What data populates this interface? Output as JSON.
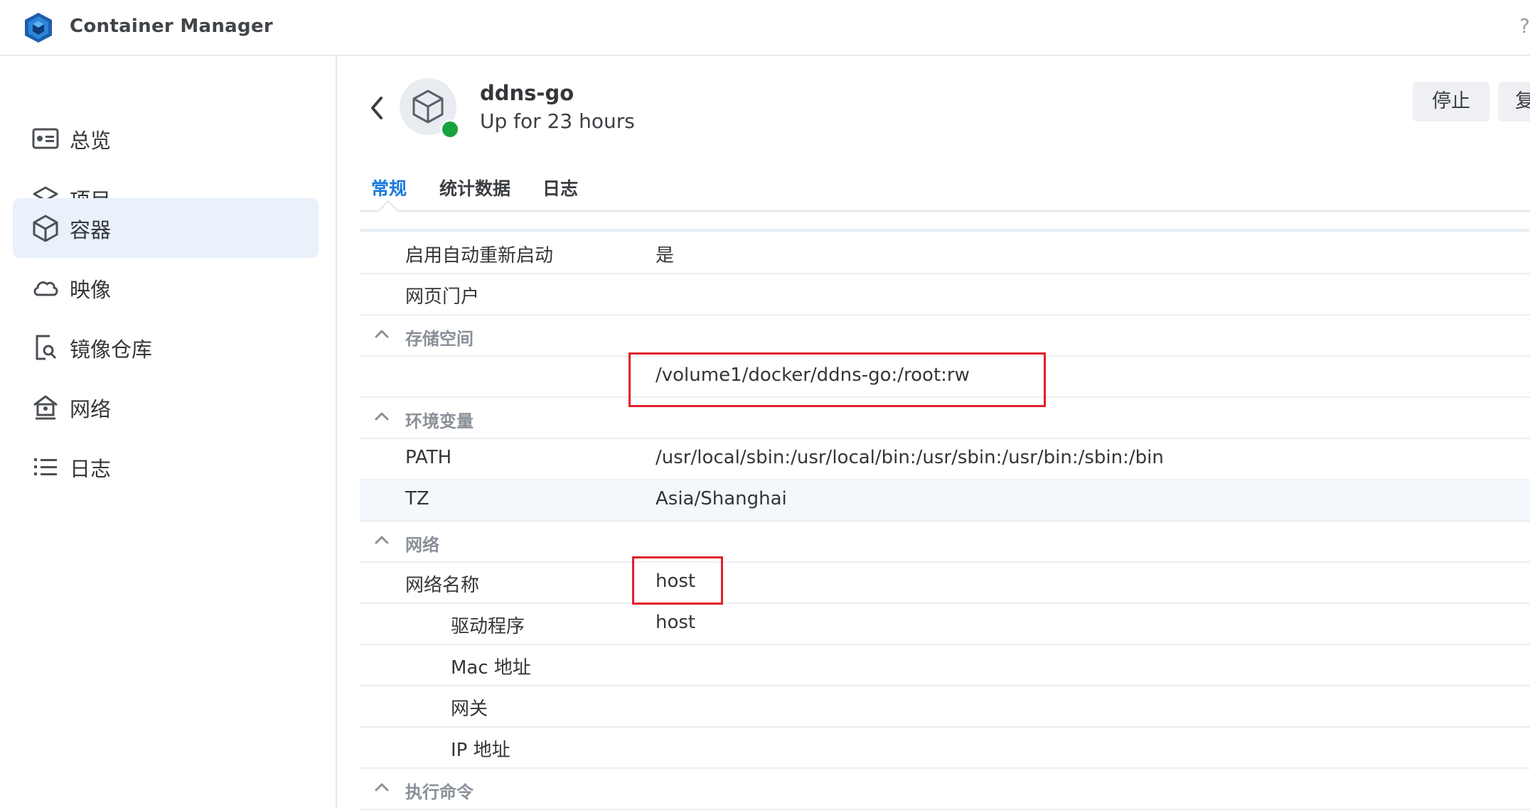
{
  "app": {
    "title": "Container Manager",
    "help_label": "?"
  },
  "sidebar": {
    "items": [
      {
        "label": "总览",
        "icon": "dashboard-icon"
      },
      {
        "label": "项目",
        "icon": "layers-icon"
      },
      {
        "label": "容器",
        "icon": "cube-icon",
        "active": true
      },
      {
        "label": "映像",
        "icon": "cloud-icon"
      },
      {
        "label": "镜像仓库",
        "icon": "registry-search-icon"
      },
      {
        "label": "网络",
        "icon": "network-house-icon"
      },
      {
        "label": "日志",
        "icon": "list-icon"
      }
    ]
  },
  "container": {
    "name": "ddns-go",
    "status": "Up for 23 hours",
    "status_color": "#19a23f"
  },
  "actions": {
    "stop": "停止",
    "copy": "复"
  },
  "tabs": [
    {
      "label": "常规",
      "active": true
    },
    {
      "label": "统计数据"
    },
    {
      "label": "日志"
    }
  ],
  "details": {
    "auto_restart": {
      "label": "启用自动重新启动",
      "value": "是"
    },
    "web_portal": {
      "label": "网页门户",
      "value": ""
    },
    "storage": {
      "section": "存储空间",
      "volume": "/volume1/docker/ddns-go:/root:rw"
    },
    "env": {
      "section": "环境变量",
      "vars": [
        {
          "key": "PATH",
          "value": "/usr/local/sbin:/usr/local/bin:/usr/sbin:/usr/bin:/sbin:/bin"
        },
        {
          "key": "TZ",
          "value": "Asia/Shanghai"
        }
      ]
    },
    "network": {
      "section": "网络",
      "name_label": "网络名称",
      "name_value": "host",
      "driver_label": "驱动程序",
      "driver_value": "host",
      "mac_label": "Mac 地址",
      "gateway_label": "网关",
      "ip_label": "IP 地址"
    },
    "exec": {
      "section": "执行命令"
    }
  },
  "accent_color": "#1a7ad9",
  "highlight_color": "#e0202a"
}
